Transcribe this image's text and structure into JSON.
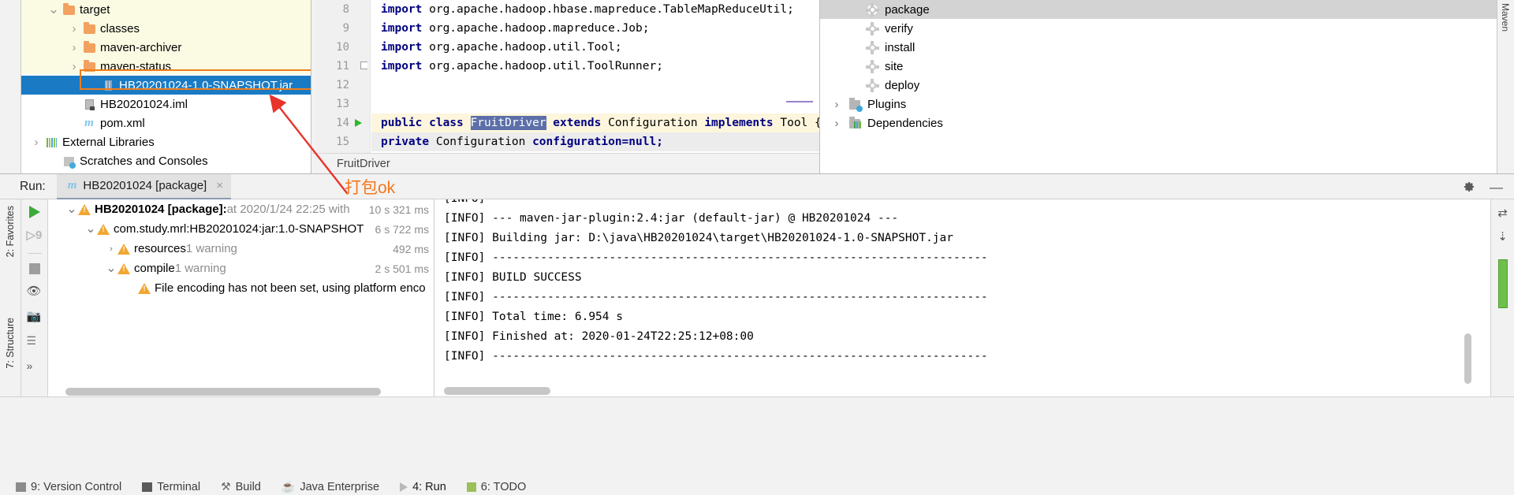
{
  "project_tree": {
    "items": [
      {
        "twisty": "v",
        "icon": "folder-icon",
        "label": "target",
        "indent": 50,
        "highlight": true,
        "selected": false
      },
      {
        "twisty": ">",
        "icon": "folder-icon",
        "label": "classes",
        "indent": 76,
        "highlight": true,
        "selected": false
      },
      {
        "twisty": ">",
        "icon": "folder-icon",
        "label": "maven-archiver",
        "indent": 76,
        "highlight": true,
        "selected": false
      },
      {
        "twisty": ">",
        "icon": "folder-icon",
        "label": "maven-status",
        "indent": 76,
        "highlight": true,
        "selected": false
      },
      {
        "twisty": "",
        "icon": "jar-icon",
        "label": "HB20201024-1.0-SNAPSHOT.jar",
        "indent": 100,
        "highlight": false,
        "selected": true
      },
      {
        "twisty": "",
        "icon": "iml-icon",
        "label": "HB20201024.iml",
        "indent": 76,
        "highlight": false,
        "selected": false
      },
      {
        "twisty": "",
        "icon": "maven-m-icon",
        "label": "pom.xml",
        "indent": 76,
        "highlight": false,
        "selected": false
      },
      {
        "twisty": ">",
        "icon": "libraries-icon",
        "label": "External Libraries",
        "indent": 28,
        "highlight": false,
        "selected": false
      },
      {
        "twisty": "",
        "icon": "scratches-icon",
        "label": "Scratches and Consoles",
        "indent": 50,
        "highlight": false,
        "selected": false
      }
    ]
  },
  "editor": {
    "lines": [
      {
        "no": "8",
        "segments": [
          {
            "t": "import",
            "c": "kw"
          },
          {
            "t": " org.apache.hadoop.hbase.mapreduce.TableMapReduceUtil;",
            "c": "plain"
          }
        ],
        "highlight": "none",
        "gutter": ""
      },
      {
        "no": "9",
        "segments": [
          {
            "t": "import",
            "c": "kw"
          },
          {
            "t": " org.apache.hadoop.mapreduce.Job;",
            "c": "plain"
          }
        ],
        "highlight": "none",
        "gutter": ""
      },
      {
        "no": "10",
        "segments": [
          {
            "t": "import",
            "c": "kw"
          },
          {
            "t": " org.apache.hadoop.util.Tool;",
            "c": "plain"
          }
        ],
        "highlight": "none",
        "gutter": ""
      },
      {
        "no": "11",
        "segments": [
          {
            "t": "import",
            "c": "kw"
          },
          {
            "t": " org.apache.hadoop.util.ToolRunner;",
            "c": "plain"
          }
        ],
        "highlight": "none",
        "gutter": "fold"
      },
      {
        "no": "12",
        "segments": [],
        "highlight": "none",
        "gutter": ""
      },
      {
        "no": "13",
        "segments": [],
        "highlight": "none",
        "gutter": ""
      },
      {
        "no": "14",
        "segments": [
          {
            "t": "public class ",
            "c": "kw"
          },
          {
            "t": "FruitDriver",
            "c": "ident-hl"
          },
          {
            "t": " ",
            "c": "plain"
          },
          {
            "t": "extends",
            "c": "kw"
          },
          {
            "t": " Configuration ",
            "c": "plain"
          },
          {
            "t": "implements",
            "c": "kw"
          },
          {
            "t": " Tool {",
            "c": "plain"
          }
        ],
        "highlight": "yellow",
        "gutter": "run"
      },
      {
        "no": "15",
        "segments": [
          {
            "t": "    private",
            "c": "kw"
          },
          {
            "t": " Configuration ",
            "c": "plain"
          },
          {
            "t": "configuration=null;",
            "c": "kw"
          }
        ],
        "highlight": "grey",
        "gutter": ""
      }
    ],
    "breadcrumb": "FruitDriver"
  },
  "maven": {
    "items": [
      {
        "twisty": "",
        "icon": "gear-icon",
        "label": "package",
        "selected": true
      },
      {
        "twisty": "",
        "icon": "gear-icon",
        "label": "verify",
        "selected": false
      },
      {
        "twisty": "",
        "icon": "gear-icon",
        "label": "install",
        "selected": false
      },
      {
        "twisty": "",
        "icon": "gear-icon",
        "label": "site",
        "selected": false
      },
      {
        "twisty": "",
        "icon": "gear-icon",
        "label": "deploy",
        "selected": false
      },
      {
        "twisty": ">",
        "icon": "plugins-icon",
        "label": "Plugins",
        "selected": false
      },
      {
        "twisty": ">",
        "icon": "dependencies-icon",
        "label": "Dependencies",
        "selected": false
      }
    ],
    "rail_label": "Maven"
  },
  "run_window": {
    "label": "Run:",
    "tab_title": "HB20201024 [package]",
    "tab_close": "×",
    "minimize": "—",
    "side_rail_favorites": "2: Favorites",
    "side_rail_structure": "7: Structure",
    "tree": [
      {
        "indent": 22,
        "twisty": "v",
        "warn": true,
        "bold": "HB20201024 [package]:",
        "rest": " at 2020/1/24 22:25 with ",
        "time": "10 s 321 ms"
      },
      {
        "indent": 46,
        "twisty": "v",
        "warn": true,
        "bold": "",
        "rest": "com.study.mrl:HB20201024:jar:1.0-SNAPSHOT",
        "time": "6 s 722 ms"
      },
      {
        "indent": 72,
        "twisty": ">",
        "warn": true,
        "bold": "",
        "rest": "resources",
        "dim": " 1 warning",
        "time": "492 ms"
      },
      {
        "indent": 72,
        "twisty": "v",
        "warn": true,
        "bold": "",
        "rest": "compile",
        "dim": " 1 warning",
        "time": "2 s 501 ms"
      },
      {
        "indent": 98,
        "twisty": "",
        "warn": true,
        "bold": "",
        "rest": "File encoding has not been set, using platform enco",
        "time": ""
      }
    ],
    "console": [
      "[INFO]",
      "[INFO] --- maven-jar-plugin:2.4:jar (default-jar) @ HB20201024 ---",
      "[INFO] Building jar: D:\\java\\HB20201024\\target\\HB20201024-1.0-SNAPSHOT.jar",
      "[INFO] ------------------------------------------------------------------------",
      "[INFO] BUILD SUCCESS",
      "[INFO] ------------------------------------------------------------------------",
      "[INFO] Total time:  6.954 s",
      "[INFO] Finished at: 2020-01-24T22:25:12+08:00",
      "[INFO] ------------------------------------------------------------------------"
    ]
  },
  "annotation": {
    "text": "打包ok",
    "color": "#f4761a"
  },
  "status_bar": {
    "items": [
      {
        "label": "9: Version Control",
        "icon": "version-control-icon"
      },
      {
        "label": "Terminal",
        "icon": "terminal-icon"
      },
      {
        "label": "Build",
        "icon": "build-icon"
      },
      {
        "label": "Java Enterprise",
        "icon": "java-enterprise-icon"
      },
      {
        "label": "4: Run",
        "icon": "run-icon",
        "active": true
      },
      {
        "label": "6: TODO",
        "icon": "todo-icon"
      }
    ]
  }
}
